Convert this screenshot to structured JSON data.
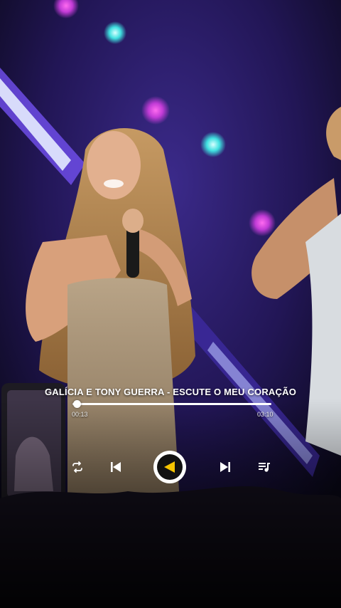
{
  "player": {
    "song_title": "GALÍCIA E TONY GUERRA - ESCUTE O MEU CORAÇÃO",
    "elapsed": "00:13",
    "total": "03:10",
    "progress": 0.02
  },
  "icons": {
    "repeat": "repeat-icon",
    "previous": "skip-previous-icon",
    "play": "play-icon",
    "next": "skip-next-icon",
    "queue": "queue-music-icon"
  },
  "colors": {
    "play_accent": "#f5c400",
    "controls": "#ffffff"
  }
}
